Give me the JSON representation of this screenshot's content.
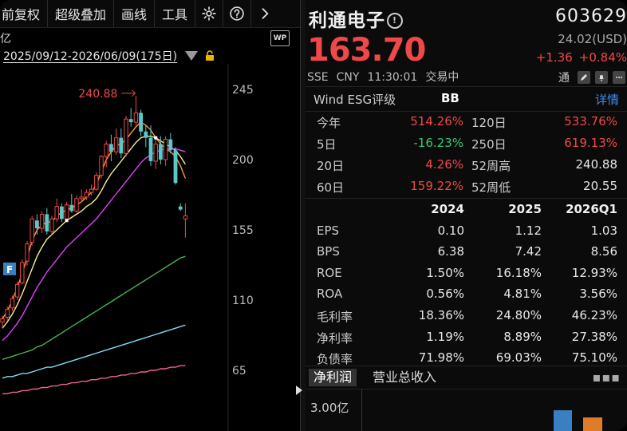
{
  "toolbar": {
    "items": [
      "前复权",
      "超级叠加",
      "画线",
      "工具"
    ],
    "icons": [
      "gear-icon",
      "help-icon",
      "chevron-right-icon"
    ]
  },
  "chart_header": {
    "unit_label": "亿",
    "badge": "WP",
    "date_range": "2025/09/12-2026/06/09(175日)"
  },
  "chart_data": {
    "type": "candlestick",
    "y_ticks": [
      "245",
      "200",
      "155",
      "110",
      "65"
    ],
    "ylim": [
      65,
      245
    ],
    "high_annotation": "240.88",
    "marker_label": "F",
    "candles": [
      {
        "o": 96,
        "h": 100,
        "l": 92,
        "c": 98,
        "up": true
      },
      {
        "o": 99,
        "h": 106,
        "l": 97,
        "c": 104,
        "up": true
      },
      {
        "o": 105,
        "h": 113,
        "l": 103,
        "c": 111,
        "up": true
      },
      {
        "o": 112,
        "h": 122,
        "l": 110,
        "c": 120,
        "up": true
      },
      {
        "o": 121,
        "h": 136,
        "l": 120,
        "c": 134,
        "up": true
      },
      {
        "o": 135,
        "h": 148,
        "l": 132,
        "c": 146,
        "up": true
      },
      {
        "o": 147,
        "h": 164,
        "l": 145,
        "c": 162,
        "up": true
      },
      {
        "o": 161,
        "h": 165,
        "l": 152,
        "c": 156,
        "up": false
      },
      {
        "o": 156,
        "h": 167,
        "l": 153,
        "c": 165,
        "up": true
      },
      {
        "o": 165,
        "h": 169,
        "l": 152,
        "c": 154,
        "up": false
      },
      {
        "o": 154,
        "h": 164,
        "l": 152,
        "c": 162,
        "up": true
      },
      {
        "o": 162,
        "h": 175,
        "l": 160,
        "c": 170,
        "up": true
      },
      {
        "o": 170,
        "h": 172,
        "l": 160,
        "c": 162,
        "up": false
      },
      {
        "o": 162,
        "h": 173,
        "l": 160,
        "c": 171,
        "up": true
      },
      {
        "o": 171,
        "h": 178,
        "l": 166,
        "c": 167,
        "up": false
      },
      {
        "o": 167,
        "h": 177,
        "l": 166,
        "c": 175,
        "up": true
      },
      {
        "o": 175,
        "h": 181,
        "l": 173,
        "c": 176,
        "up": true
      },
      {
        "o": 176,
        "h": 181,
        "l": 174,
        "c": 179,
        "up": true
      },
      {
        "o": 179,
        "h": 184,
        "l": 177,
        "c": 181,
        "up": true
      },
      {
        "o": 181,
        "h": 192,
        "l": 180,
        "c": 190,
        "up": true
      },
      {
        "o": 190,
        "h": 203,
        "l": 188,
        "c": 202,
        "up": true
      },
      {
        "o": 202,
        "h": 212,
        "l": 195,
        "c": 210,
        "up": true
      },
      {
        "o": 210,
        "h": 216,
        "l": 199,
        "c": 205,
        "up": false
      },
      {
        "o": 205,
        "h": 220,
        "l": 203,
        "c": 214,
        "up": true
      },
      {
        "o": 214,
        "h": 220,
        "l": 201,
        "c": 204,
        "up": false
      },
      {
        "o": 204,
        "h": 228,
        "l": 202,
        "c": 226,
        "up": true
      },
      {
        "o": 226,
        "h": 233,
        "l": 221,
        "c": 224,
        "up": false
      },
      {
        "o": 224,
        "h": 241,
        "l": 222,
        "c": 230,
        "up": true
      },
      {
        "o": 230,
        "h": 232,
        "l": 215,
        "c": 218,
        "up": false
      },
      {
        "o": 218,
        "h": 222,
        "l": 208,
        "c": 214,
        "up": false
      },
      {
        "o": 214,
        "h": 222,
        "l": 196,
        "c": 199,
        "up": false
      },
      {
        "o": 199,
        "h": 214,
        "l": 194,
        "c": 210,
        "up": true
      },
      {
        "o": 210,
        "h": 215,
        "l": 197,
        "c": 200,
        "up": false
      },
      {
        "o": 200,
        "h": 215,
        "l": 196,
        "c": 213,
        "up": true
      },
      {
        "o": 213,
        "h": 217,
        "l": 204,
        "c": 206,
        "up": false
      },
      {
        "o": 206,
        "h": 208,
        "l": 184,
        "c": 185,
        "up": false
      },
      {
        "o": 170,
        "h": 172,
        "l": 167,
        "c": 168,
        "up": false
      },
      {
        "o": 162,
        "h": 172,
        "l": 150,
        "c": 164,
        "up": true
      }
    ],
    "ma_lines": [
      {
        "name": "MA5",
        "color": "#ff9a3c",
        "values": [
          98,
          103,
          110,
          118,
          127,
          137,
          148,
          155,
          158,
          160,
          160,
          164,
          166,
          168,
          169,
          171,
          173,
          176,
          179,
          184,
          192,
          200,
          205,
          209,
          210,
          213,
          217,
          221,
          224,
          222,
          219,
          214,
          210,
          207,
          205,
          202,
          196,
          188
        ]
      },
      {
        "name": "MA10",
        "color": "#f5f08a",
        "values": [
          92,
          96,
          101,
          107,
          114,
          122,
          130,
          138,
          144,
          149,
          152,
          155,
          158,
          161,
          163,
          165,
          167,
          170,
          172,
          175,
          180,
          186,
          191,
          195,
          199,
          203,
          207,
          211,
          214,
          215,
          215,
          214,
          212,
          210,
          208,
          206,
          202,
          197
        ]
      },
      {
        "name": "MA20",
        "color": "#e040fb",
        "values": [
          84,
          87,
          91,
          95,
          100,
          106,
          112,
          118,
          123,
          128,
          132,
          136,
          140,
          144,
          147,
          150,
          153,
          156,
          159,
          162,
          166,
          170,
          174,
          178,
          182,
          186,
          190,
          194,
          198,
          201,
          203,
          205,
          206,
          207,
          207,
          207,
          206,
          205
        ]
      },
      {
        "name": "MA60",
        "color": "#4caf50",
        "values": [
          72,
          73,
          74,
          75,
          76,
          77,
          78,
          80,
          81,
          83,
          85,
          87,
          89,
          91,
          93,
          95,
          97,
          99,
          101,
          103,
          105,
          107,
          109,
          111,
          113,
          115,
          117,
          119,
          121,
          123,
          125,
          127,
          129,
          131,
          133,
          135,
          137,
          138
        ]
      },
      {
        "name": "MA120",
        "color": "#80deea",
        "values": [
          60,
          61,
          61,
          62,
          63,
          63,
          64,
          65,
          66,
          67,
          67,
          68,
          69,
          70,
          71,
          72,
          73,
          74,
          75,
          76,
          77,
          78,
          79,
          80,
          81,
          82,
          83,
          84,
          85,
          86,
          87,
          88,
          89,
          90,
          91,
          92,
          93,
          94
        ]
      },
      {
        "name": "MA250",
        "color": "#f06292",
        "values": [
          50,
          50,
          51,
          51,
          52,
          52,
          53,
          53,
          54,
          54,
          55,
          55,
          56,
          56,
          57,
          57,
          58,
          58,
          59,
          59,
          60,
          60,
          61,
          61,
          62,
          62,
          63,
          63,
          64,
          64,
          65,
          65,
          66,
          66,
          67,
          67,
          68,
          68
        ]
      }
    ]
  },
  "quote": {
    "name": "利通电子",
    "code": "603629",
    "price": "163.70",
    "usd_price": "24.02(USD)",
    "change": "+1.36",
    "change_pct": "+0.84%",
    "exchange": "SSE",
    "currency": "CNY",
    "time": "11:30:01",
    "status": "交易中",
    "tong_label": "通"
  },
  "esg": {
    "label": "Wind ESG评级",
    "grade": "BB",
    "detail": "详情"
  },
  "performance": [
    {
      "l1": "今年",
      "v1": "514.26%",
      "c1": "red",
      "l2": "120日",
      "v2": "533.76%",
      "c2": "red"
    },
    {
      "l1": "5日",
      "v1": "-16.23%",
      "c1": "green",
      "l2": "250日",
      "v2": "619.13%",
      "c2": "red"
    },
    {
      "l1": "20日",
      "v1": "4.26%",
      "c1": "red",
      "l2": "52周高",
      "v2": "240.88",
      "c2": "white"
    },
    {
      "l1": "60日",
      "v1": "159.22%",
      "c1": "red",
      "l2": "52周低",
      "v2": "20.55",
      "c2": "white"
    }
  ],
  "financials": {
    "headers": [
      "",
      "2024",
      "2025",
      "2026Q1"
    ],
    "rows": [
      [
        "EPS",
        "0.10",
        "1.12",
        "1.03"
      ],
      [
        "BPS",
        "6.38",
        "7.42",
        "8.56"
      ],
      [
        "ROE",
        "1.50%",
        "16.18%",
        "12.93%"
      ],
      [
        "ROA",
        "0.56%",
        "4.81%",
        "3.56%"
      ],
      [
        "毛利率",
        "18.36%",
        "24.80%",
        "46.23%"
      ],
      [
        "净利率",
        "1.19%",
        "8.89%",
        "27.38%"
      ],
      [
        "负债率",
        "71.98%",
        "69.03%",
        "75.10%"
      ]
    ]
  },
  "tabs": [
    "净利润",
    "营业总收入"
  ],
  "bottom": {
    "amount": "3.00亿"
  },
  "colors": {
    "up": "#f04848",
    "down": "#5bc8c8",
    "accent": "#3d8ff0"
  }
}
